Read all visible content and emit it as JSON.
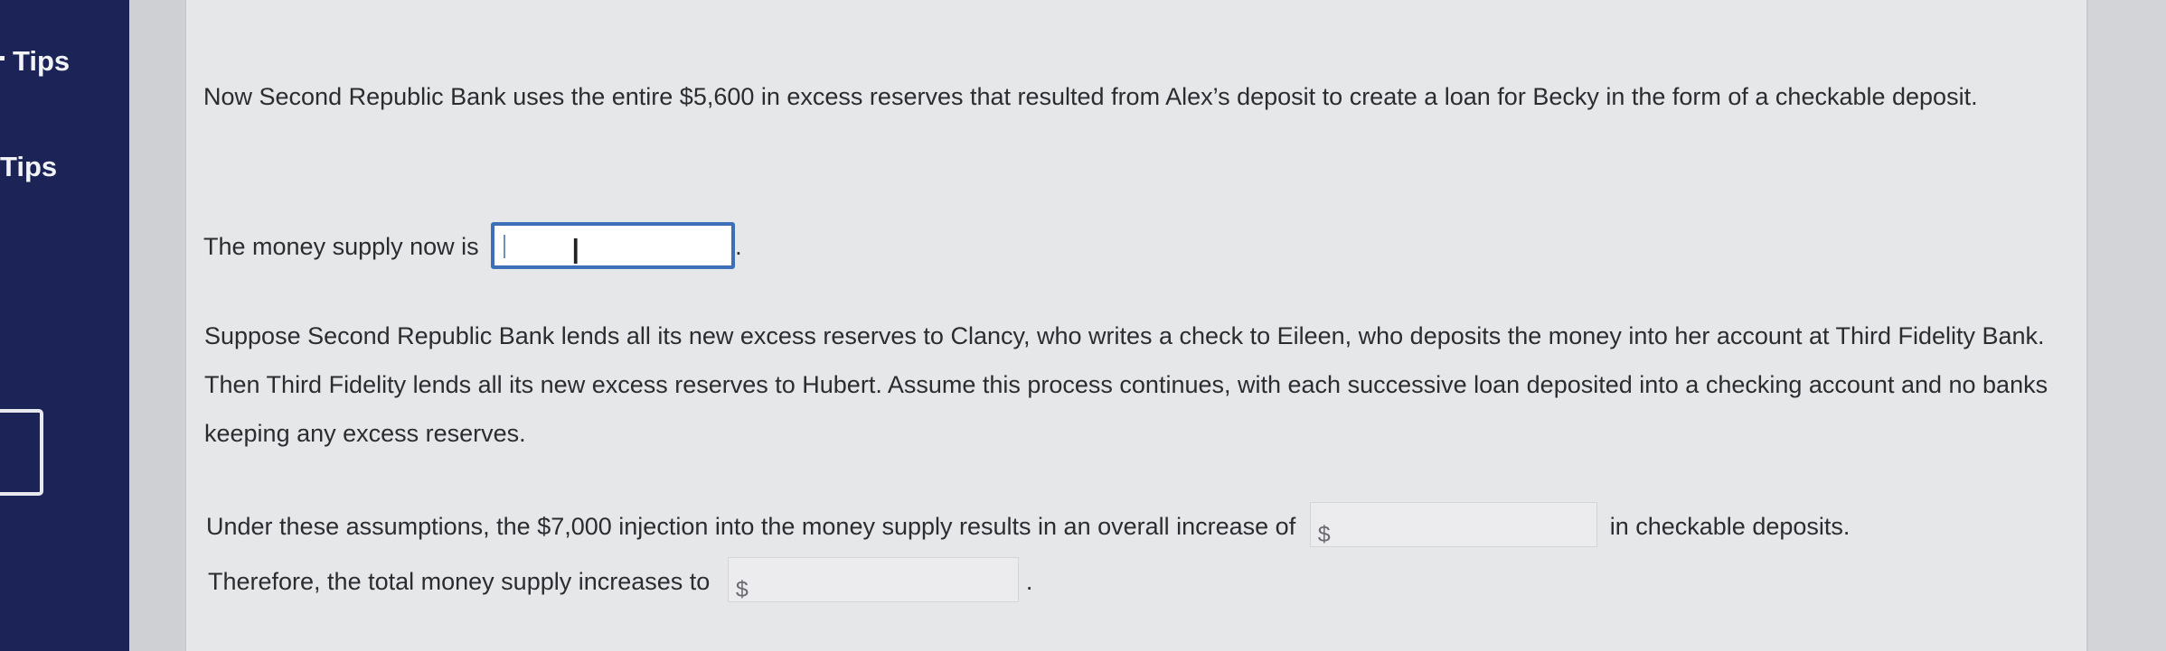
{
  "sidebar": {
    "tips_label_1": "Tips",
    "tips_label_2": "Tips"
  },
  "question": {
    "intro": "Now Second Republic Bank uses the entire $5,600 in excess reserves that resulted from Alex’s deposit to create a loan for Becky in the form of a checkable deposit.",
    "money_supply_prefix": "The money supply now is",
    "money_supply_value": "",
    "money_supply_suffix": ".",
    "scenario": "Suppose Second Republic Bank lends all its new excess reserves to Clancy, who writes a check to Eileen, who deposits the money into her account at Third Fidelity Bank. Then Third Fidelity lends all its new excess reserves to Hubert. Assume this process continues, with each successive loan deposited into a checking account and no banks keeping any excess reserves.",
    "assumption_prefix": "Under these assumptions, the $7,000 injection into the money supply results in an overall increase of",
    "assumption_suffix": "in checkable deposits.",
    "increase_currency": "$",
    "increase_value": "",
    "total_prefix": "Therefore, the total money supply increases to",
    "total_currency": "$",
    "total_value": "",
    "total_suffix": "."
  }
}
